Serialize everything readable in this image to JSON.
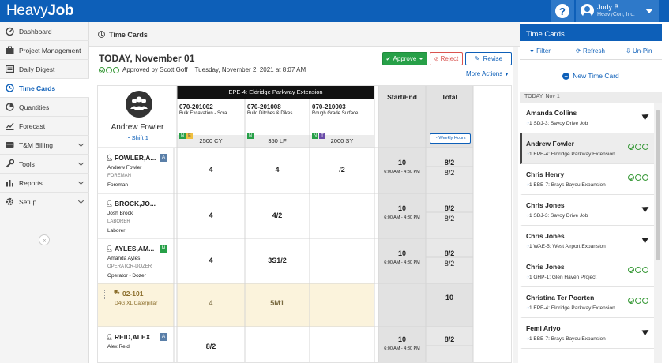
{
  "header": {
    "logo_light": "Heavy",
    "logo_bold": "Job",
    "help": "?",
    "user_name": "Jody B",
    "user_company": "HeavyCon, Inc."
  },
  "sidebar": {
    "items": [
      {
        "label": "Dashboard"
      },
      {
        "label": "Project Management"
      },
      {
        "label": "Daily Digest"
      },
      {
        "label": "Time Cards"
      },
      {
        "label": "Quantities"
      },
      {
        "label": "Forecast"
      },
      {
        "label": "T&M Billing"
      },
      {
        "label": "Tools"
      },
      {
        "label": "Reports"
      },
      {
        "label": "Setup"
      }
    ],
    "collapse": "«"
  },
  "breadcrumb": "Time Cards",
  "page": {
    "title": "TODAY, November 01",
    "status_text": "Approved by Scott Goff",
    "status_date": "Tuesday, November 2, 2021 at 8:07 AM",
    "approve": "Approve",
    "reject": "Reject",
    "revise": "Revise",
    "more_actions": "More Actions"
  },
  "grid": {
    "foreman_name": "Andrew Fowler",
    "shift": "Shift 1",
    "job_header": "EPE-4: Eldridge Parkway Extension",
    "start_end_header": "Start/End",
    "total_header": "Total",
    "weekly_hours": "Weekly Hours",
    "cost_codes": [
      {
        "code": "070-201002",
        "desc": "Bulk Excavation - Scra...",
        "badges": [
          "N",
          "E"
        ],
        "qty": "2500 CY"
      },
      {
        "code": "070-201008",
        "desc": "Build Ditches & Dikes",
        "badges": [
          "N"
        ],
        "qty": "350 LF"
      },
      {
        "code": "070-210003",
        "desc": "Rough Grade Surface",
        "badges": [
          "N",
          "T"
        ],
        "qty": "2000 SY"
      }
    ],
    "rows": [
      {
        "badge": "A",
        "id": "FOWLER,A...",
        "name": "Andrew Fowler",
        "role": "FOREMAN",
        "trade": "Foreman",
        "hours": [
          "4",
          "4",
          "/2"
        ],
        "start": "10",
        "times": "6:00 AM - 4:30 PM",
        "total_top": "8/2",
        "total_bottom": "8/2"
      },
      {
        "badge": "",
        "id": "BROCK,JO...",
        "name": "Josh Brock",
        "role": "LABORER",
        "trade": "Laborer",
        "hours": [
          "4",
          "4/2",
          ""
        ],
        "start": "10",
        "times": "6:00 AM - 4:30 PM",
        "total_top": "8/2",
        "total_bottom": "8/2"
      },
      {
        "badge": "N",
        "id": "AYLES,AM...",
        "name": "Amanda Ayles",
        "role": "OPERATOR-DOZER",
        "trade": "Operator - Dozer",
        "hours": [
          "4",
          "3S1/2",
          ""
        ],
        "start": "10",
        "times": "6:00 AM - 4:30 PM",
        "total_top": "8/2",
        "total_bottom": "8/2"
      },
      {
        "badge": "A",
        "id": "REID,ALEX",
        "name": "Alex Reid",
        "role": "",
        "trade": "",
        "hours": [
          "8/2",
          "",
          ""
        ],
        "start": "10",
        "times": "6:00 AM - 4:30 PM",
        "total_top": "8/2",
        "total_bottom": ""
      }
    ],
    "equipment": {
      "id": "02-101",
      "desc": "D4G XL Caterpillar",
      "hours": [
        "4",
        "5M1",
        ""
      ],
      "total": "10"
    }
  },
  "panel": {
    "title": "Time Cards",
    "filter": "Filter",
    "refresh": "Refresh",
    "unpin": "Un-Pin",
    "new_card": "New Time Card",
    "date_label": "TODAY, Nov 1",
    "cards": [
      {
        "name": "Amanda Collins",
        "job": "SDJ-3: Savoy Drive Job",
        "status": "sent"
      },
      {
        "name": "Andrew Fowler",
        "job": "EPE-4: Eldridge Parkway Extension",
        "status": "approved"
      },
      {
        "name": "Chris Henry",
        "job": "BBE-7: Brays Bayou Expansion",
        "status": "approved"
      },
      {
        "name": "Chris Jones",
        "job": "SDJ-3: Savoy Drive Job",
        "status": "sent"
      },
      {
        "name": "Chris Jones",
        "job": "WAE-5: West Airport Expansion",
        "status": "sent"
      },
      {
        "name": "Chris Jones",
        "job": "GHP-1: Glen Haven Project",
        "status": "approved"
      },
      {
        "name": "Christina Ter Poorten",
        "job": "EPE-4: Eldridge Parkway Extension",
        "status": "approved"
      },
      {
        "name": "Femi Ariyo",
        "job": "BBE-7: Brays Bayou Expansion",
        "status": "sent"
      }
    ],
    "shift_no": "1"
  }
}
